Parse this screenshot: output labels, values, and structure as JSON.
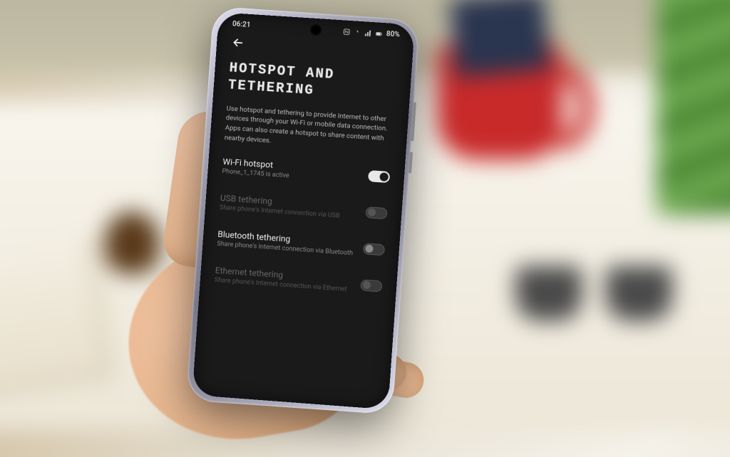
{
  "status_bar": {
    "time": "06:21",
    "battery_pct": "80%",
    "icons": [
      "nfc-icon",
      "vibrate-icon",
      "wifi-icon"
    ]
  },
  "header": {
    "title_line1": "HOTSPOT AND",
    "title_line2": "TETHERING",
    "description": "Use hotspot and tethering to provide Internet to other devices through your Wi-Fi or mobile data connection. Apps can also create a hotspot to share content with nearby devices."
  },
  "settings": [
    {
      "key": "wifi_hotspot",
      "title": "Wi-Fi hotspot",
      "subtitle": "Phone_1_1745 is active",
      "toggled": true,
      "enabled": true
    },
    {
      "key": "usb_tethering",
      "title": "USB tethering",
      "subtitle": "Share phone's Internet connection via USB",
      "toggled": false,
      "enabled": false
    },
    {
      "key": "bluetooth_tethering",
      "title": "Bluetooth tethering",
      "subtitle": "Share phone's Internet connection via Bluetooth",
      "toggled": false,
      "enabled": true
    },
    {
      "key": "ethernet_tethering",
      "title": "Ethernet tethering",
      "subtitle": "Share phone's Internet connection via Ethernet",
      "toggled": false,
      "enabled": false
    }
  ]
}
